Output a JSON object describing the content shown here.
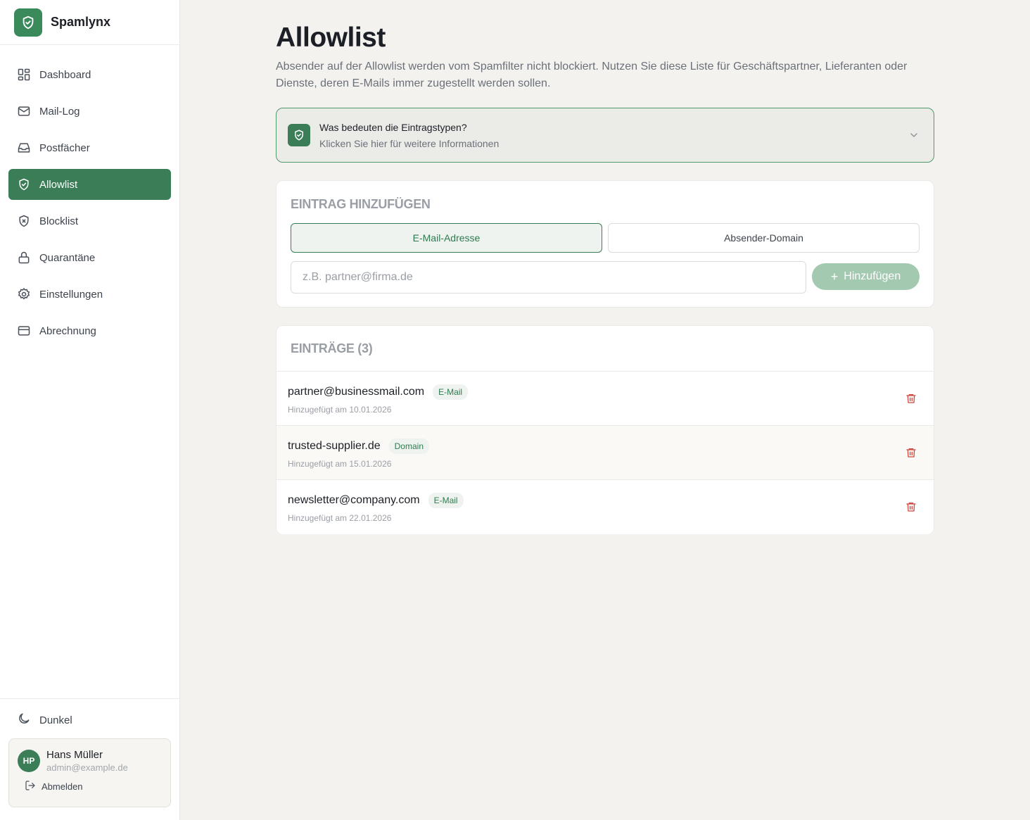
{
  "brand": {
    "name": "Spamlynx",
    "icon": "shield-check-icon"
  },
  "nav": [
    {
      "label": "Dashboard",
      "icon": "dashboard-icon"
    },
    {
      "label": "Mail-Log",
      "icon": "mail-icon"
    },
    {
      "label": "Postfächer",
      "icon": "inbox-icon"
    },
    {
      "label": "Allowlist",
      "icon": "shield-check-icon",
      "active": true
    },
    {
      "label": "Blocklist",
      "icon": "shield-x-icon"
    },
    {
      "label": "Quarantäne",
      "icon": "lock-icon"
    },
    {
      "label": "Einstellungen",
      "icon": "gear-icon"
    },
    {
      "label": "Abrechnung",
      "icon": "credit-card-icon"
    }
  ],
  "theme_toggle": {
    "label": "Dunkel",
    "icon": "moon-icon"
  },
  "user": {
    "initials": "HP",
    "name": "Hans Müller",
    "email": "admin@example.de",
    "logout_label": "Abmelden"
  },
  "page": {
    "title": "Allowlist",
    "description": "Absender auf der Allowlist werden vom Spamfilter nicht blockiert. Nutzen Sie diese Liste für Geschäftspartner, Lieferanten oder Dienste, deren E-Mails immer zugestellt werden sollen."
  },
  "info": {
    "title": "Was bedeuten die Eintragstypen?",
    "subtitle": "Klicken Sie hier für weitere Informationen"
  },
  "add_entry": {
    "title": "EINTRAG HINZUFÜGEN",
    "type_email": "E-Mail-Adresse",
    "type_domain": "Absender-Domain",
    "selected_type": "E-Mail-Adresse",
    "input_placeholder": "z.B. partner@firma.de",
    "input_value": "",
    "add_button": "Hinzufügen"
  },
  "entries": {
    "title": "EINTRÄGE (3)",
    "items": [
      {
        "value": "partner@businessmail.com",
        "type": "E-Mail",
        "date": "Hinzugefügt am 10.01.2026"
      },
      {
        "value": "trusted-supplier.de",
        "type": "Domain",
        "date": "Hinzugefügt am 15.01.2026"
      },
      {
        "value": "newsletter@company.com",
        "type": "E-Mail",
        "date": "Hinzugefügt am 22.01.2026"
      }
    ]
  },
  "colors": {
    "accent": "#3a7d57",
    "accent_light": "#eef3ef",
    "background": "#f3f2ef",
    "danger": "#d0473f"
  }
}
